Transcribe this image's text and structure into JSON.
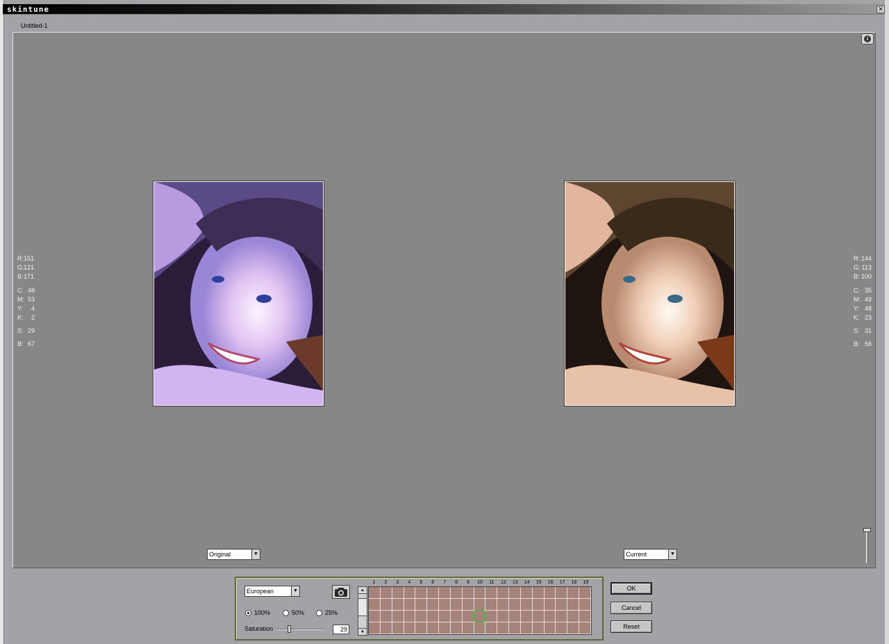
{
  "window": {
    "title": "skintune",
    "close_glyph": "✕"
  },
  "document_tab": "Untitled-1",
  "preview": {
    "info_icon_glyph": "i",
    "left_readout": {
      "R": "151",
      "G": "121",
      "B_rgb": "171",
      "C": "48",
      "M": "53",
      "Y": "4",
      "K": "2",
      "S": "29",
      "B_hsb": "67"
    },
    "right_readout": {
      "R": "144",
      "G": "113",
      "B_rgb": "100",
      "C": "35",
      "M": "49",
      "Y": "48",
      "K": "23",
      "S": "31",
      "B_hsb": "56"
    },
    "left_view": {
      "selected": "Original"
    },
    "right_view": {
      "selected": "Current"
    }
  },
  "controls": {
    "skin_type": "European",
    "radio_100": "100%",
    "radio_50": "50%",
    "radio_25": "25%",
    "radio_selected": "100%",
    "saturation_label": "Saturation",
    "saturation_value": "29",
    "saturation_level": 0.29,
    "grid_columns": [
      "1",
      "2",
      "3",
      "4",
      "5",
      "6",
      "7",
      "8",
      "9",
      "10",
      "11",
      "12",
      "13",
      "14",
      "15",
      "16",
      "17",
      "18",
      "19"
    ],
    "grid_selected_column": "10"
  },
  "buttons": {
    "ok": "OK",
    "cancel": "Cancel",
    "reset": "Reset"
  },
  "colors": {
    "preview_bg": "#878787",
    "tone_cell": "#a5827a",
    "selection": "#35c035"
  }
}
